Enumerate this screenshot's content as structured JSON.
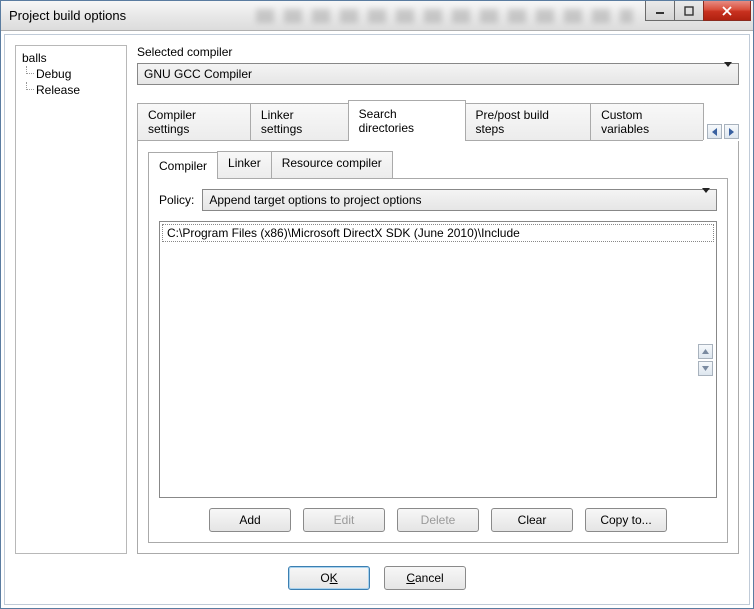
{
  "window": {
    "title": "Project build options"
  },
  "tree": {
    "root": "balls",
    "children": [
      "Debug",
      "Release"
    ]
  },
  "compiler_section": {
    "label": "Selected compiler",
    "value": "GNU GCC Compiler"
  },
  "tabs": {
    "items": [
      "Compiler settings",
      "Linker settings",
      "Search directories",
      "Pre/post build steps",
      "Custom variables"
    ],
    "active_index": 2
  },
  "inner_tabs": {
    "items": [
      "Compiler",
      "Linker",
      "Resource compiler"
    ],
    "active_index": 0
  },
  "policy": {
    "label": "Policy:",
    "value": "Append target options to project options"
  },
  "directories": {
    "items": [
      "C:\\Program Files (x86)\\Microsoft DirectX SDK (June 2010)\\Include"
    ]
  },
  "dir_buttons": {
    "add": "Add",
    "edit": "Edit",
    "delete": "Delete",
    "clear": "Clear",
    "copyto": "Copy to..."
  },
  "dialog_buttons": {
    "ok_pre": "O",
    "ok_u": "K",
    "cancel_u": "C",
    "cancel_post": "ancel"
  }
}
